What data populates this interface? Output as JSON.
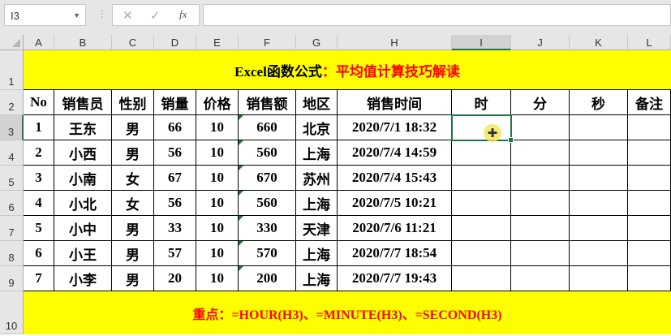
{
  "formula_bar": {
    "name_box": "I3",
    "cancel_icon": "✕",
    "enter_icon": "✓",
    "fx_label": "fx",
    "formula": ""
  },
  "columns": [
    "A",
    "B",
    "C",
    "D",
    "E",
    "F",
    "G",
    "H",
    "I",
    "J",
    "K",
    "L"
  ],
  "rows": [
    "1",
    "2",
    "3",
    "4",
    "5",
    "6",
    "7",
    "8",
    "9",
    "10"
  ],
  "title": {
    "black": "Excel函数公式",
    "red": "：平均值计算技巧解读"
  },
  "headers": [
    "No",
    "销售员",
    "性别",
    "销量",
    "价格",
    "销售额",
    "地区",
    "销售时间",
    "时",
    "分",
    "秒",
    "备注"
  ],
  "data": [
    [
      "1",
      "王东",
      "男",
      "66",
      "10",
      "660",
      "北京",
      "2020/7/1 18:32",
      "",
      "",
      "",
      ""
    ],
    [
      "2",
      "小西",
      "男",
      "56",
      "10",
      "560",
      "上海",
      "2020/7/4 14:59",
      "",
      "",
      "",
      ""
    ],
    [
      "3",
      "小南",
      "女",
      "67",
      "10",
      "670",
      "苏州",
      "2020/7/4 15:43",
      "",
      "",
      "",
      ""
    ],
    [
      "4",
      "小北",
      "女",
      "56",
      "10",
      "560",
      "上海",
      "2020/7/5 10:21",
      "",
      "",
      "",
      ""
    ],
    [
      "5",
      "小中",
      "男",
      "33",
      "10",
      "330",
      "天津",
      "2020/7/6 11:21",
      "",
      "",
      "",
      ""
    ],
    [
      "6",
      "小王",
      "男",
      "57",
      "10",
      "570",
      "上海",
      "2020/7/7 18:54",
      "",
      "",
      "",
      ""
    ],
    [
      "7",
      "小李",
      "男",
      "20",
      "10",
      "200",
      "上海",
      "2020/7/7 19:43",
      "",
      "",
      "",
      ""
    ]
  ],
  "note": "重点：=HOUR(H3)、=MINUTE(H3)、=SECOND(H3)",
  "colors": {
    "band": "#ffff00",
    "red": "#ff0000",
    "selection": "#217346"
  }
}
